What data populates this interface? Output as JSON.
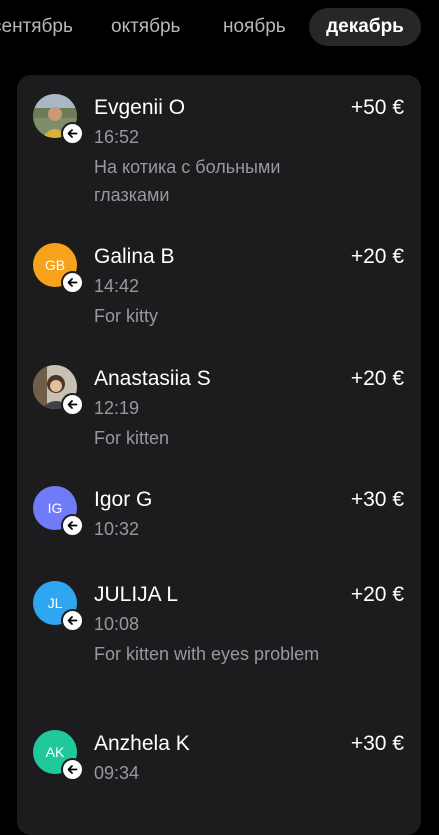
{
  "months": {
    "tabs": [
      "сентябрь",
      "октябрь",
      "ноябрь",
      "декабрь"
    ],
    "selected": "декабрь"
  },
  "colors": {
    "background": "#000000",
    "card": "#1c1c1e",
    "selected_tab": "#272729",
    "secondary_text": "#98989d"
  },
  "transactions": [
    {
      "name": "Evgenii O",
      "amount": "+50 €",
      "time": "16:52",
      "comment": "На котика с больными глазками",
      "avatar": "photo"
    },
    {
      "name": "Galina B",
      "amount": "+20 €",
      "time": "14:42",
      "comment": "For kitty",
      "initials": "GB",
      "color": "#f7a21b"
    },
    {
      "name": "Anastasiia S",
      "amount": "+20 €",
      "time": "12:19",
      "comment": "For kitten",
      "avatar": "photo"
    },
    {
      "name": "Igor G",
      "amount": "+30 €",
      "time": "10:32",
      "initials": "IG",
      "color": "#6f7bf7"
    },
    {
      "name": "JULIJA L",
      "amount": "+20 €",
      "time": "10:08",
      "comment": "For kitten with eyes problem",
      "initials": "JL",
      "color": "#2ea6f0"
    },
    {
      "name": "Anzhela K",
      "amount": "+30 €",
      "time": "09:34",
      "initials": "AK",
      "color": "#1fc99a"
    }
  ],
  "icons": {
    "incoming": "arrow-left-icon"
  }
}
